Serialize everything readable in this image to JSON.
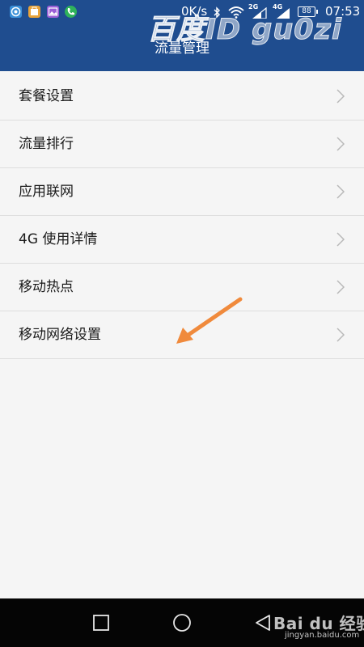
{
  "status_bar": {
    "net_speed": "0K/s",
    "sim1_label": "2G",
    "sim2_label": "4G",
    "battery": "88",
    "time": "07:53"
  },
  "watermark": "百度ID gu0zi",
  "header": {
    "title": "流量管理"
  },
  "menu": {
    "items": [
      {
        "label": "套餐设置"
      },
      {
        "label": "流量排行"
      },
      {
        "label": "应用联网"
      },
      {
        "label": "4G 使用详情"
      },
      {
        "label": "移动热点"
      },
      {
        "label": "移动网络设置"
      }
    ]
  },
  "colors": {
    "header_bg": "#1f4d8f",
    "list_bg": "#f5f5f5",
    "annotation_arrow": "#f08a3c",
    "navbar_bg": "#050505"
  },
  "footer_watermark": {
    "logo": "Bai du 经验",
    "url": "jingyan.baidu.com"
  }
}
